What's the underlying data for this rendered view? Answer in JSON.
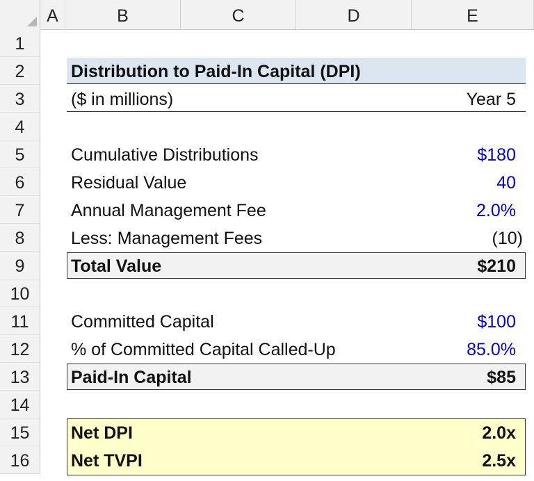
{
  "columns": [
    "A",
    "B",
    "C",
    "D",
    "E"
  ],
  "rows": [
    "1",
    "2",
    "3",
    "4",
    "5",
    "6",
    "7",
    "8",
    "9",
    "10",
    "11",
    "12",
    "13",
    "14",
    "15",
    "16"
  ],
  "title": "Distribution to Paid-In Capital (DPI)",
  "units_label": "($ in millions)",
  "year_label": "Year 5",
  "lines": {
    "cum_dist": {
      "label": "Cumulative Distributions",
      "value": "$180"
    },
    "residual": {
      "label": "Residual Value",
      "value": "40"
    },
    "mgmt_fee_rate": {
      "label": "Annual Management Fee",
      "value": "2.0%"
    },
    "less_fees": {
      "label": "Less: Management Fees",
      "value": "(10)"
    },
    "total_value": {
      "label": "Total Value",
      "value": "$210"
    },
    "committed": {
      "label": "Committed Capital",
      "value": "$100"
    },
    "pct_called": {
      "label": "% of Committed Capital Called-Up",
      "value": "85.0%"
    },
    "paid_in": {
      "label": "Paid-In Capital",
      "value": "$85"
    },
    "net_dpi": {
      "label": "Net DPI",
      "value": "2.0x"
    },
    "net_tvpi": {
      "label": "Net TVPI",
      "value": "2.5x"
    }
  },
  "colors": {
    "title_fill": "#dce6f1",
    "total_fill": "#f2f2f2",
    "result_fill": "#ffffcc",
    "input_blue": "#0000d8"
  }
}
